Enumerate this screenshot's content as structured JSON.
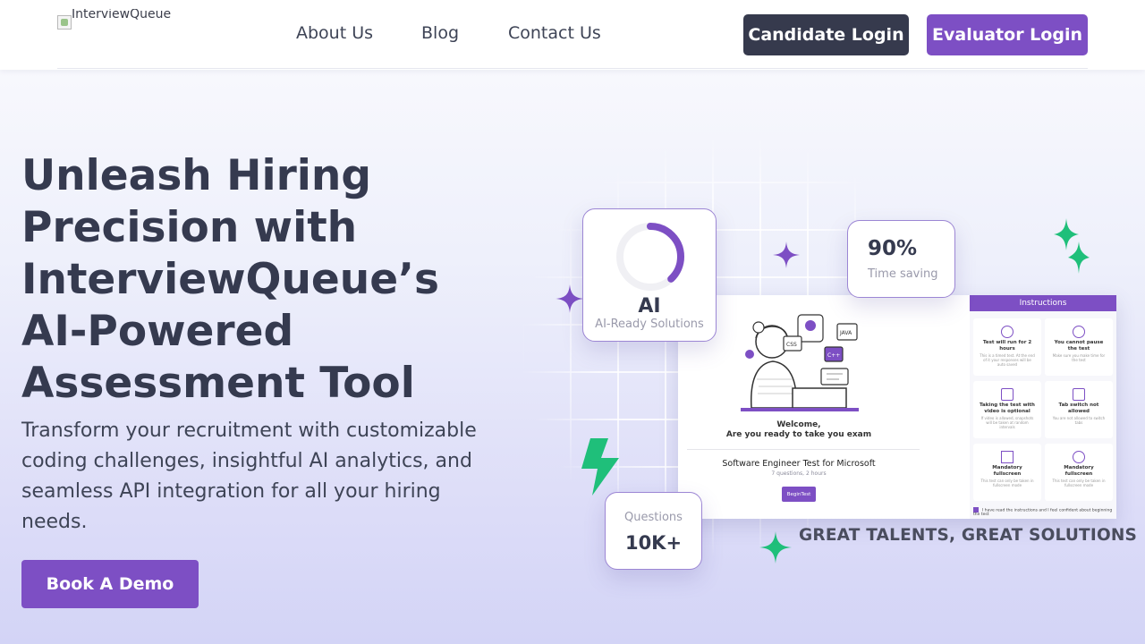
{
  "header": {
    "logo_alt": "InterviewQueue",
    "nav": [
      {
        "label": "About Us"
      },
      {
        "label": "Blog"
      },
      {
        "label": "Contact Us"
      }
    ],
    "candidate_login": "Candidate Login",
    "evaluator_login": "Evaluator Login"
  },
  "hero": {
    "title": "Unleash Hiring Precision with InterviewQueue’s AI-Powered Assessment Tool",
    "subtitle": "Transform your recruitment with customizable coding challenges, insightful AI analytics, and seamless API integration for all your hiring needs.",
    "cta": "Book A Demo"
  },
  "illustration": {
    "ai_card": {
      "value": "AI",
      "label": "AI-Ready Solutions",
      "progress": 0.38
    },
    "time_card": {
      "value": "90%",
      "label": "Time saving"
    },
    "questions_card": {
      "label": "Questions",
      "value": "10K+"
    },
    "screen": {
      "welcome_line1": "Welcome,",
      "welcome_line2": "Are you ready to take you exam",
      "test_title": "Software Engineer Test for Microsoft",
      "test_meta": "7 questions, 2 hours",
      "begin_button": "BeginTest",
      "badges": [
        "CSS",
        "JAVA",
        "C++"
      ],
      "instructions_title": "Instructions",
      "instructions": [
        {
          "title": "Test will run for 2 hours",
          "desc": "This is a timed test. At the end of it your responses will be auto saved"
        },
        {
          "title": "You cannot pause the test",
          "desc": "Make sure you make time for the test"
        },
        {
          "title": "Taking the test with video is optional",
          "desc": "If video is allowed, snapshots will be taken at random intervals"
        },
        {
          "title": "Tab switch not allowed",
          "desc": "You are not allowed to switch tabs"
        },
        {
          "title": "Mandatory fullscreen",
          "desc": "This test can only be taken in fullscreen mode"
        },
        {
          "title": "Mandatory fullscreen",
          "desc": "This test can only be taken in fullscreen mode"
        }
      ],
      "agree_text": "I have read the instructions and I feel confident about beginning the test"
    },
    "slogan": "GREAT TALENTS, GREAT SOLUTIONS"
  },
  "colors": {
    "primary_purple": "#7d4fc4",
    "dark_button": "#363a4d",
    "accent_green": "#1fbf7a"
  }
}
